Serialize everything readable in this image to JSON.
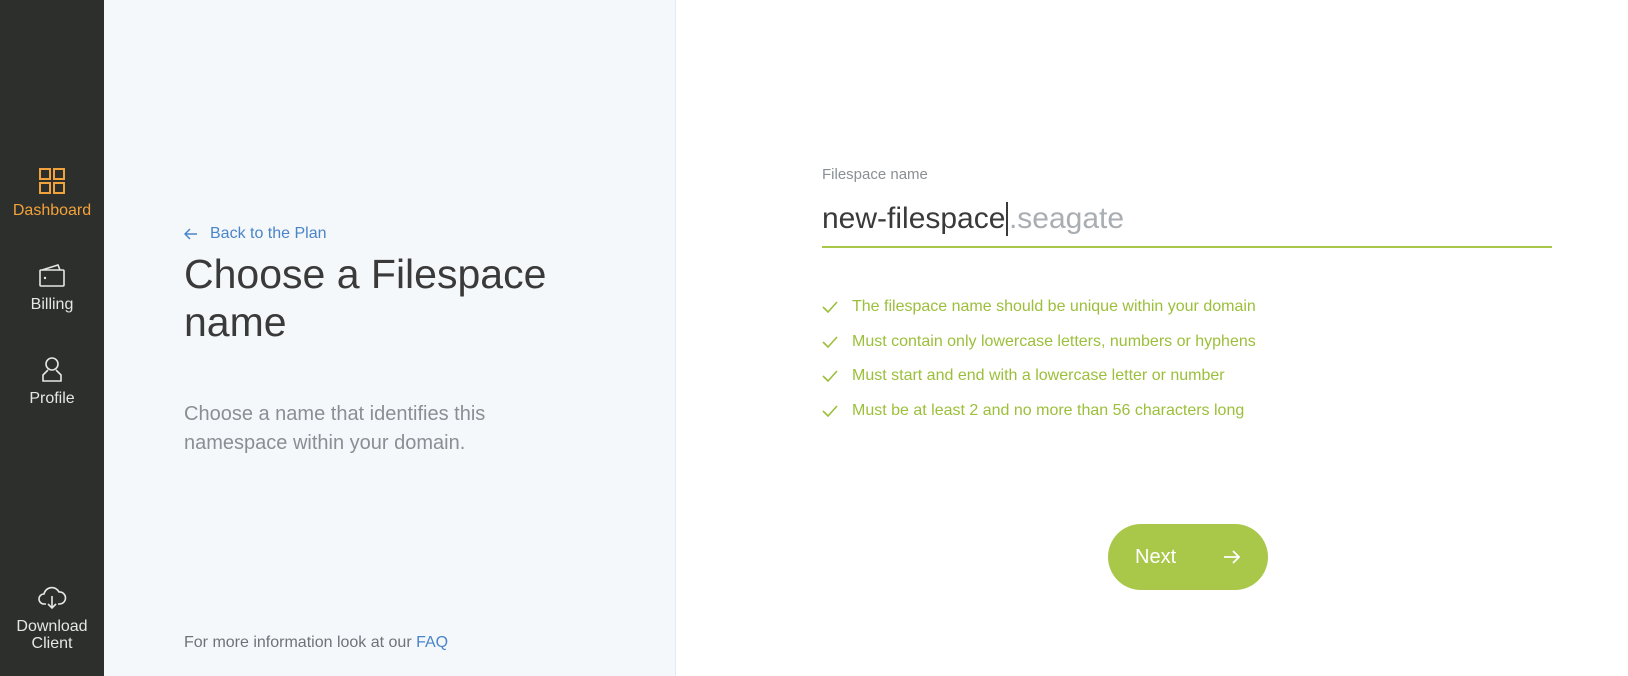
{
  "colors": {
    "sidebar_bg": "#2d2f2c",
    "active_accent": "#f2a23a",
    "primary_green": "#a9c84a",
    "rule_green": "#9cbf3a",
    "link_blue": "#4a84c9",
    "left_panel_bg": "#f5f8fb"
  },
  "sidebar": {
    "items": [
      {
        "label": "Dashboard",
        "icon": "dashboard-grid-icon",
        "active": true
      },
      {
        "label": "Billing",
        "icon": "wallet-icon",
        "active": false
      },
      {
        "label": "Profile",
        "icon": "user-icon",
        "active": false
      }
    ],
    "download": {
      "line1": "Download",
      "line2": "Client",
      "icon": "cloud-download-icon"
    }
  },
  "left": {
    "back_label": "Back to the Plan",
    "title": "Choose a Filespace name",
    "description": "Choose a name that identifies this namespace within your domain.",
    "footer_text": "For more information look at our",
    "faq_label": "FAQ"
  },
  "form": {
    "field_label": "Filespace name",
    "field_value": "new-filespace",
    "field_suffix": ".seagate",
    "rules": [
      "The filespace name should be unique within your domain",
      "Must contain only lowercase letters, numbers or hyphens",
      "Must start and end with a lowercase letter or number",
      "Must be at least 2 and no more than 56 characters long"
    ],
    "next_label": "Next"
  }
}
